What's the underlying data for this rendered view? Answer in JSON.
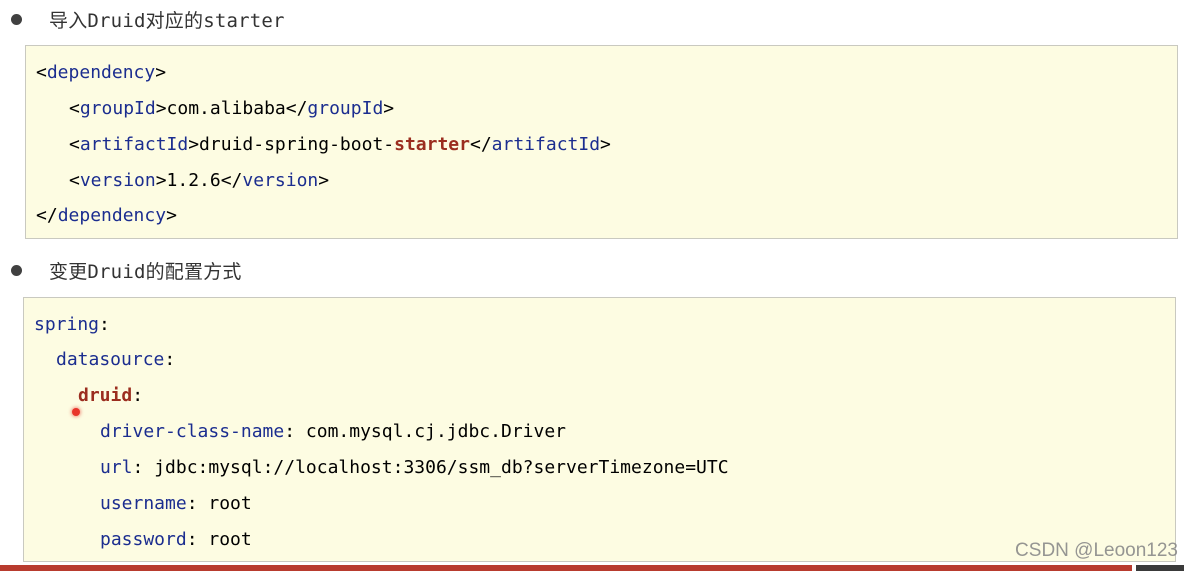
{
  "section1": {
    "heading": "导入Druid对应的starter",
    "code": {
      "l1_open": "<",
      "l1_tag": "dependency",
      "l1_close": ">",
      "l2_open": "<",
      "l2_tag": "groupId",
      "l2_mid": ">com.alibaba</",
      "l2_tag2": "groupId",
      "l2_close": ">",
      "l3_open": "<",
      "l3_tag": "artifactId",
      "l3_mid": ">druid-spring-boot-",
      "l3_kw": "starter",
      "l3_mid2": "</",
      "l3_tag2": "artifactId",
      "l3_close": ">",
      "l4_open": "<",
      "l4_tag": "version",
      "l4_mid": ">1.2.6</",
      "l4_tag2": "version",
      "l4_close": ">",
      "l5_open": "</",
      "l5_tag": "dependency",
      "l5_close": ">"
    }
  },
  "section2": {
    "heading": "变更Druid的配置方式",
    "code": {
      "spring_key": "spring",
      "datasource_key": "datasource",
      "druid_key": "druid",
      "colon": ":",
      "driver_key": "driver-class-name",
      "driver_val": " com.mysql.cj.jdbc.Driver",
      "url_key": "url",
      "url_val": " jdbc:mysql://localhost:3306/ssm_db?serverTimezone=UTC",
      "username_key": "username",
      "username_val": " root",
      "password_key": "password",
      "password_val": " root"
    }
  },
  "watermark": "CSDN @Leoon123",
  "colors": {
    "code_bg": "#fdfce2",
    "tag_blue": "#1b2d8f",
    "keyword_red": "#9b2d1f",
    "bottom_bar": "#b83b2e"
  }
}
